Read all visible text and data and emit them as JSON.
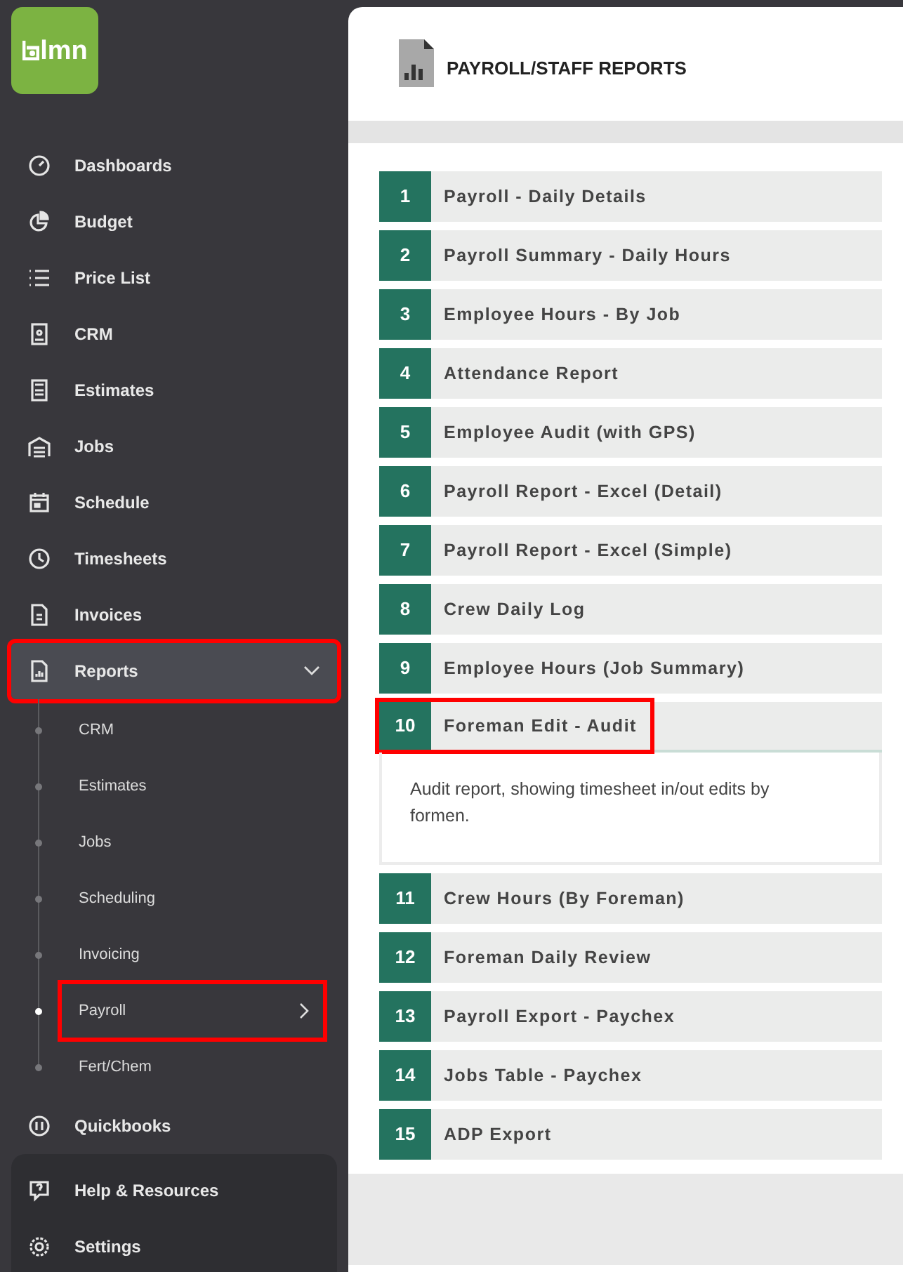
{
  "logo": {
    "text": "lmn"
  },
  "nav": [
    {
      "label": "Dashboards",
      "expanded": false,
      "highlighted": false
    },
    {
      "label": "Budget",
      "expanded": false,
      "highlighted": false
    },
    {
      "label": "Price List",
      "expanded": false,
      "highlighted": false
    },
    {
      "label": "CRM",
      "expanded": false,
      "highlighted": false
    },
    {
      "label": "Estimates",
      "expanded": false,
      "highlighted": false
    },
    {
      "label": "Jobs",
      "expanded": false,
      "highlighted": false
    },
    {
      "label": "Schedule",
      "expanded": false,
      "highlighted": false
    },
    {
      "label": "Timesheets",
      "expanded": false,
      "highlighted": false
    },
    {
      "label": "Invoices",
      "expanded": false,
      "highlighted": false
    },
    {
      "label": "Reports",
      "expanded": true,
      "highlighted": true,
      "children": [
        {
          "label": "CRM",
          "selected": false,
          "highlighted": false
        },
        {
          "label": "Estimates",
          "selected": false,
          "highlighted": false
        },
        {
          "label": "Jobs",
          "selected": false,
          "highlighted": false
        },
        {
          "label": "Scheduling",
          "selected": false,
          "highlighted": false
        },
        {
          "label": "Invoicing",
          "selected": false,
          "highlighted": false
        },
        {
          "label": "Payroll",
          "selected": true,
          "highlighted": true
        },
        {
          "label": "Fert/Chem",
          "selected": false,
          "highlighted": false
        }
      ]
    },
    {
      "label": "Quickbooks",
      "expanded": false,
      "highlighted": false
    }
  ],
  "footer_nav": [
    {
      "label": "Help & Resources"
    },
    {
      "label": "Settings"
    }
  ],
  "page_title": "PAYROLL/STAFF REPORTS",
  "reports": [
    {
      "number": "1",
      "title": "Payroll - Daily Details",
      "expanded": false,
      "highlighted": false
    },
    {
      "number": "2",
      "title": "Payroll Summary - Daily Hours",
      "expanded": false,
      "highlighted": false
    },
    {
      "number": "3",
      "title": "Employee Hours - By Job",
      "expanded": false,
      "highlighted": false
    },
    {
      "number": "4",
      "title": "Attendance Report",
      "expanded": false,
      "highlighted": false
    },
    {
      "number": "5",
      "title": "Employee Audit (with GPS)",
      "expanded": false,
      "highlighted": false
    },
    {
      "number": "6",
      "title": "Payroll Report - Excel (Detail)",
      "expanded": false,
      "highlighted": false
    },
    {
      "number": "7",
      "title": "Payroll Report - Excel (Simple)",
      "expanded": false,
      "highlighted": false
    },
    {
      "number": "8",
      "title": "Crew Daily Log",
      "expanded": false,
      "highlighted": false
    },
    {
      "number": "9",
      "title": "Employee Hours (Job Summary)",
      "expanded": false,
      "highlighted": false
    },
    {
      "number": "10",
      "title": "Foreman Edit - Audit",
      "expanded": true,
      "highlighted": true,
      "description": "Audit report, showing timesheet in/out edits by formen."
    },
    {
      "number": "11",
      "title": "Crew Hours (By Foreman)",
      "expanded": false,
      "highlighted": false
    },
    {
      "number": "12",
      "title": "Foreman Daily Review",
      "expanded": false,
      "highlighted": false
    },
    {
      "number": "13",
      "title": "Payroll Export - Paychex",
      "expanded": false,
      "highlighted": false
    },
    {
      "number": "14",
      "title": "Jobs Table - Paychex",
      "expanded": false,
      "highlighted": false
    },
    {
      "number": "15",
      "title": "ADP Export",
      "expanded": false,
      "highlighted": false
    }
  ]
}
